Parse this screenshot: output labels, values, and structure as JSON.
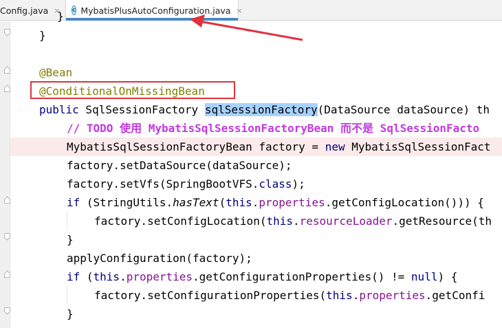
{
  "tabs": [
    {
      "label": "isConfig.java",
      "close": "×"
    },
    {
      "label": "MybatisPlusAutoConfiguration.java",
      "close": "×",
      "icon_letter": "c"
    }
  ],
  "code": {
    "l0": "}",
    "l1": "}",
    "l3": "@Bean",
    "l4": "@ConditionalOnMissingBean",
    "l5": {
      "kw": "public",
      "type": " SqlSessionFactory ",
      "method": "sqlSessionFactory",
      "rest": "(DataSource dataSource) th"
    },
    "l6": "// TODO 使用 MybatisSqlSessionFactoryBean 而不是 SqlSessionFacto",
    "l7": {
      "a": "MybatisSqlSessionFactoryBean factory = ",
      "kw": "new",
      "b": " MybatisSqlSessionFact"
    },
    "l8": "factory.setDataSource(dataSource);",
    "l9": {
      "a": "factory.setVfs(SpringBootVFS.",
      "kw": "class",
      "b": ");"
    },
    "l10": {
      "kw": "if",
      "a": " (StringUtils.",
      "it": "hasText",
      "b": "(",
      "kw2": "this",
      "c": ".",
      "field": "properties",
      "d": ".getConfigLocation())) {"
    },
    "l11": {
      "a": "factory.setConfigLocation(",
      "kw": "this",
      "b": ".",
      "field": "resourceLoader",
      "c": ".getResource(th"
    },
    "l12": "}",
    "l13": "applyConfiguration(factory);",
    "l14": {
      "kw": "if",
      "a": " (",
      "kw2": "this",
      "b": ".",
      "field": "properties",
      "c": ".getConfigurationProperties() != ",
      "kw3": "null",
      "d": ") {"
    },
    "l15": {
      "a": "factory.setConfigurationProperties(",
      "kw": "this",
      "b": ".",
      "field": "properties",
      "c": ".getConfi"
    },
    "l16": "}"
  },
  "colors": {
    "keyword": "#000080",
    "annotation": "#808000",
    "field": "#871094",
    "todo": "#c238e1",
    "selection": "#a6d2ff",
    "annotation_box": "#e0323c",
    "arrow": "#e0323c",
    "active_tab_underline": "#4a88c7"
  }
}
